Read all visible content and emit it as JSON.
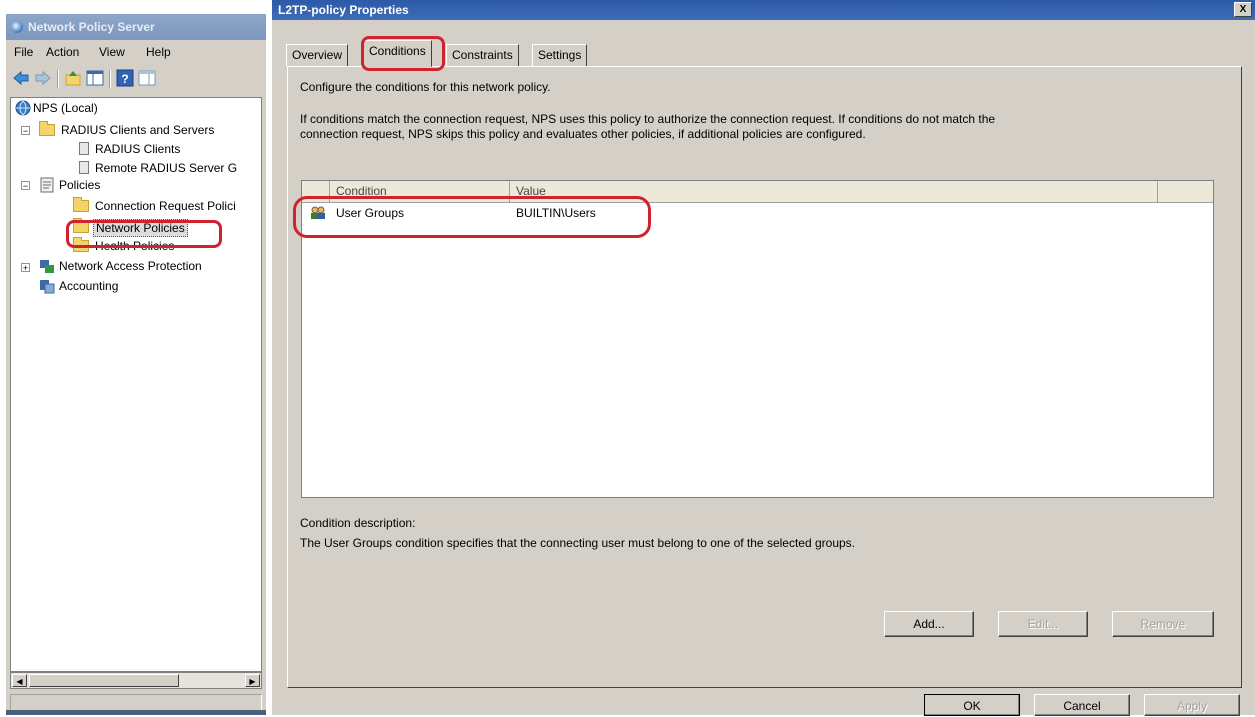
{
  "mmc": {
    "title": "Network Policy Server",
    "menu": [
      "File",
      "Action",
      "View",
      "Help"
    ],
    "tree": {
      "root": "NPS (Local)",
      "radius_group": "RADIUS Clients and Servers",
      "radius_clients": "RADIUS Clients",
      "remote_radius": "Remote RADIUS Server G",
      "policies": "Policies",
      "connection_request": "Connection Request Polici",
      "network_policies": "Network Policies",
      "health_policies": "Health Policies",
      "nap": "Network Access Protection",
      "accounting": "Accounting"
    }
  },
  "dialog": {
    "title": "L2TP-policy Properties",
    "close_glyph": "X",
    "tabs": [
      "Overview",
      "Conditions",
      "Constraints",
      "Settings"
    ],
    "active_tab": "Conditions",
    "intro": "Configure the conditions for this network policy.",
    "explanation_line1": "If conditions match the connection request, NPS uses this policy to authorize the connection request. If conditions do not match the",
    "explanation_line2": "connection request, NPS skips this policy and evaluates other policies, if additional policies are configured.",
    "columns": [
      "Condition",
      "Value"
    ],
    "rows": [
      {
        "condition": "User Groups",
        "value": "BUILTIN\\Users",
        "icon": "user-group-icon"
      }
    ],
    "description_label": "Condition description:",
    "description_text": "The User Groups condition specifies that the connecting user must belong to one of the selected groups.",
    "buttons": {
      "add": "Add...",
      "edit": "Edit...",
      "remove": "Remove",
      "ok": "OK",
      "cancel": "Cancel",
      "apply": "Apply"
    }
  },
  "colors": {
    "highlight_marker": "#d0232e",
    "dialog_title_bar": "#2d5aa8",
    "window_face": "#d4d0c8"
  }
}
